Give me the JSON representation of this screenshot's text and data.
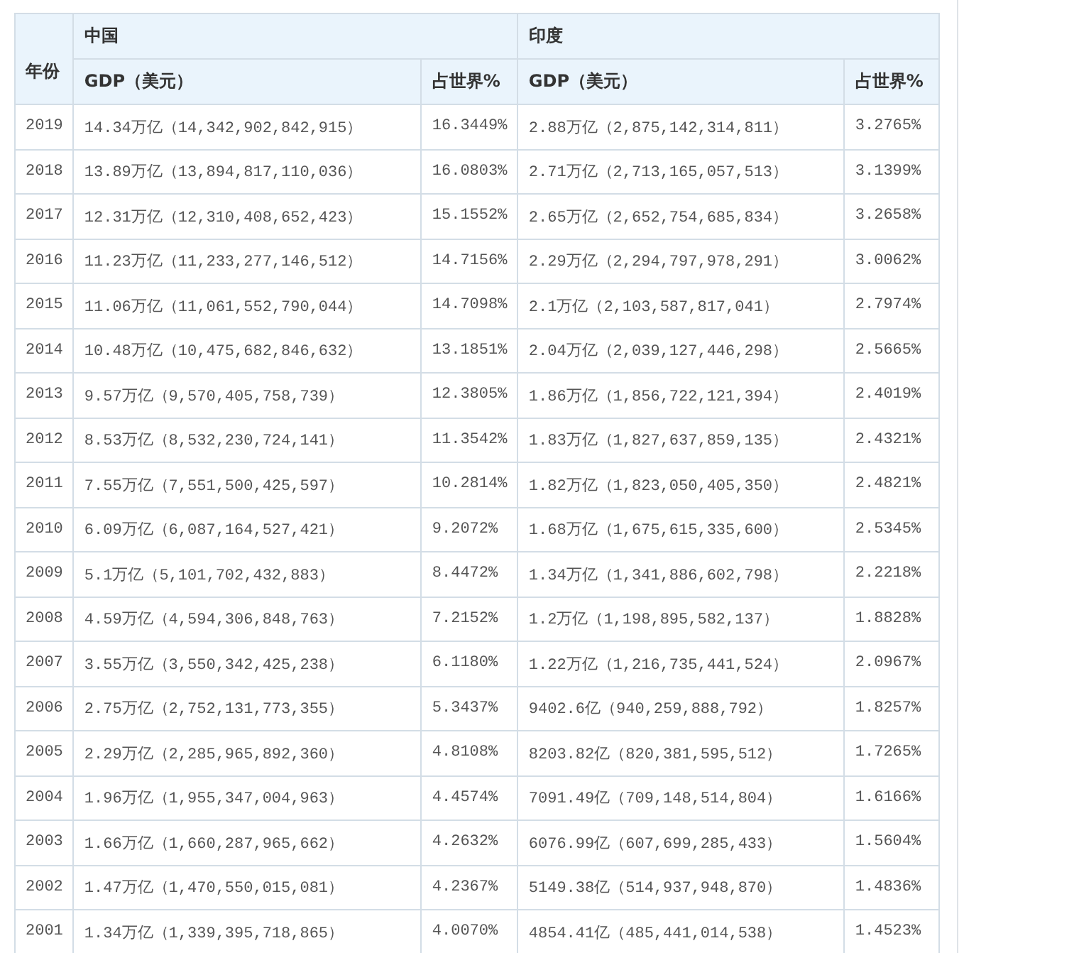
{
  "table": {
    "year_header": "年份",
    "groups": [
      {
        "name": "中国",
        "columns": [
          "GDP（美元）",
          "占世界%"
        ]
      },
      {
        "name": "印度",
        "columns": [
          "GDP（美元）",
          "占世界%"
        ]
      }
    ],
    "rows": [
      {
        "year": "2019",
        "cells": [
          "14.34万亿（14,342,902,842,915）",
          "16.3449%",
          "2.88万亿（2,875,142,314,811）",
          "3.2765%"
        ]
      },
      {
        "year": "2018",
        "cells": [
          "13.89万亿（13,894,817,110,036）",
          "16.0803%",
          "2.71万亿（2,713,165,057,513）",
          "3.1399%"
        ]
      },
      {
        "year": "2017",
        "cells": [
          "12.31万亿（12,310,408,652,423）",
          "15.1552%",
          "2.65万亿（2,652,754,685,834）",
          "3.2658%"
        ]
      },
      {
        "year": "2016",
        "cells": [
          "11.23万亿（11,233,277,146,512）",
          "14.7156%",
          "2.29万亿（2,294,797,978,291）",
          "3.0062%"
        ]
      },
      {
        "year": "2015",
        "cells": [
          "11.06万亿（11,061,552,790,044）",
          "14.7098%",
          "2.1万亿（2,103,587,817,041）",
          "2.7974%"
        ]
      },
      {
        "year": "2014",
        "cells": [
          "10.48万亿（10,475,682,846,632）",
          "13.1851%",
          "2.04万亿（2,039,127,446,298）",
          "2.5665%"
        ]
      },
      {
        "year": "2013",
        "cells": [
          "9.57万亿（9,570,405,758,739）",
          "12.3805%",
          "1.86万亿（1,856,722,121,394）",
          "2.4019%"
        ]
      },
      {
        "year": "2012",
        "cells": [
          "8.53万亿（8,532,230,724,141）",
          "11.3542%",
          "1.83万亿（1,827,637,859,135）",
          "2.4321%"
        ]
      },
      {
        "year": "2011",
        "cells": [
          "7.55万亿（7,551,500,425,597）",
          "10.2814%",
          "1.82万亿（1,823,050,405,350）",
          "2.4821%"
        ]
      },
      {
        "year": "2010",
        "cells": [
          "6.09万亿（6,087,164,527,421）",
          "9.2072%",
          "1.68万亿（1,675,615,335,600）",
          "2.5345%"
        ]
      },
      {
        "year": "2009",
        "cells": [
          "5.1万亿（5,101,702,432,883）",
          "8.4472%",
          "1.34万亿（1,341,886,602,798）",
          "2.2218%"
        ]
      },
      {
        "year": "2008",
        "cells": [
          "4.59万亿（4,594,306,848,763）",
          "7.2152%",
          "1.2万亿（1,198,895,582,137）",
          "1.8828%"
        ]
      },
      {
        "year": "2007",
        "cells": [
          "3.55万亿（3,550,342,425,238）",
          "6.1180%",
          "1.22万亿（1,216,735,441,524）",
          "2.0967%"
        ]
      },
      {
        "year": "2006",
        "cells": [
          "2.75万亿（2,752,131,773,355）",
          "5.3437%",
          "9402.6亿（940,259,888,792）",
          "1.8257%"
        ]
      },
      {
        "year": "2005",
        "cells": [
          "2.29万亿（2,285,965,892,360）",
          "4.8108%",
          "8203.82亿（820,381,595,512）",
          "1.7265%"
        ]
      },
      {
        "year": "2004",
        "cells": [
          "1.96万亿（1,955,347,004,963）",
          "4.4574%",
          "7091.49亿（709,148,514,804）",
          "1.6166%"
        ]
      },
      {
        "year": "2003",
        "cells": [
          "1.66万亿（1,660,287,965,662）",
          "4.2632%",
          "6076.99亿（607,699,285,433）",
          "1.5604%"
        ]
      },
      {
        "year": "2002",
        "cells": [
          "1.47万亿（1,470,550,015,081）",
          "4.2367%",
          "5149.38亿（514,937,948,870）",
          "1.4836%"
        ]
      },
      {
        "year": "2001",
        "cells": [
          "1.34万亿（1,339,395,718,865）",
          "4.0070%",
          "4854.41亿（485,441,014,538）",
          "1.4523%"
        ]
      }
    ]
  }
}
